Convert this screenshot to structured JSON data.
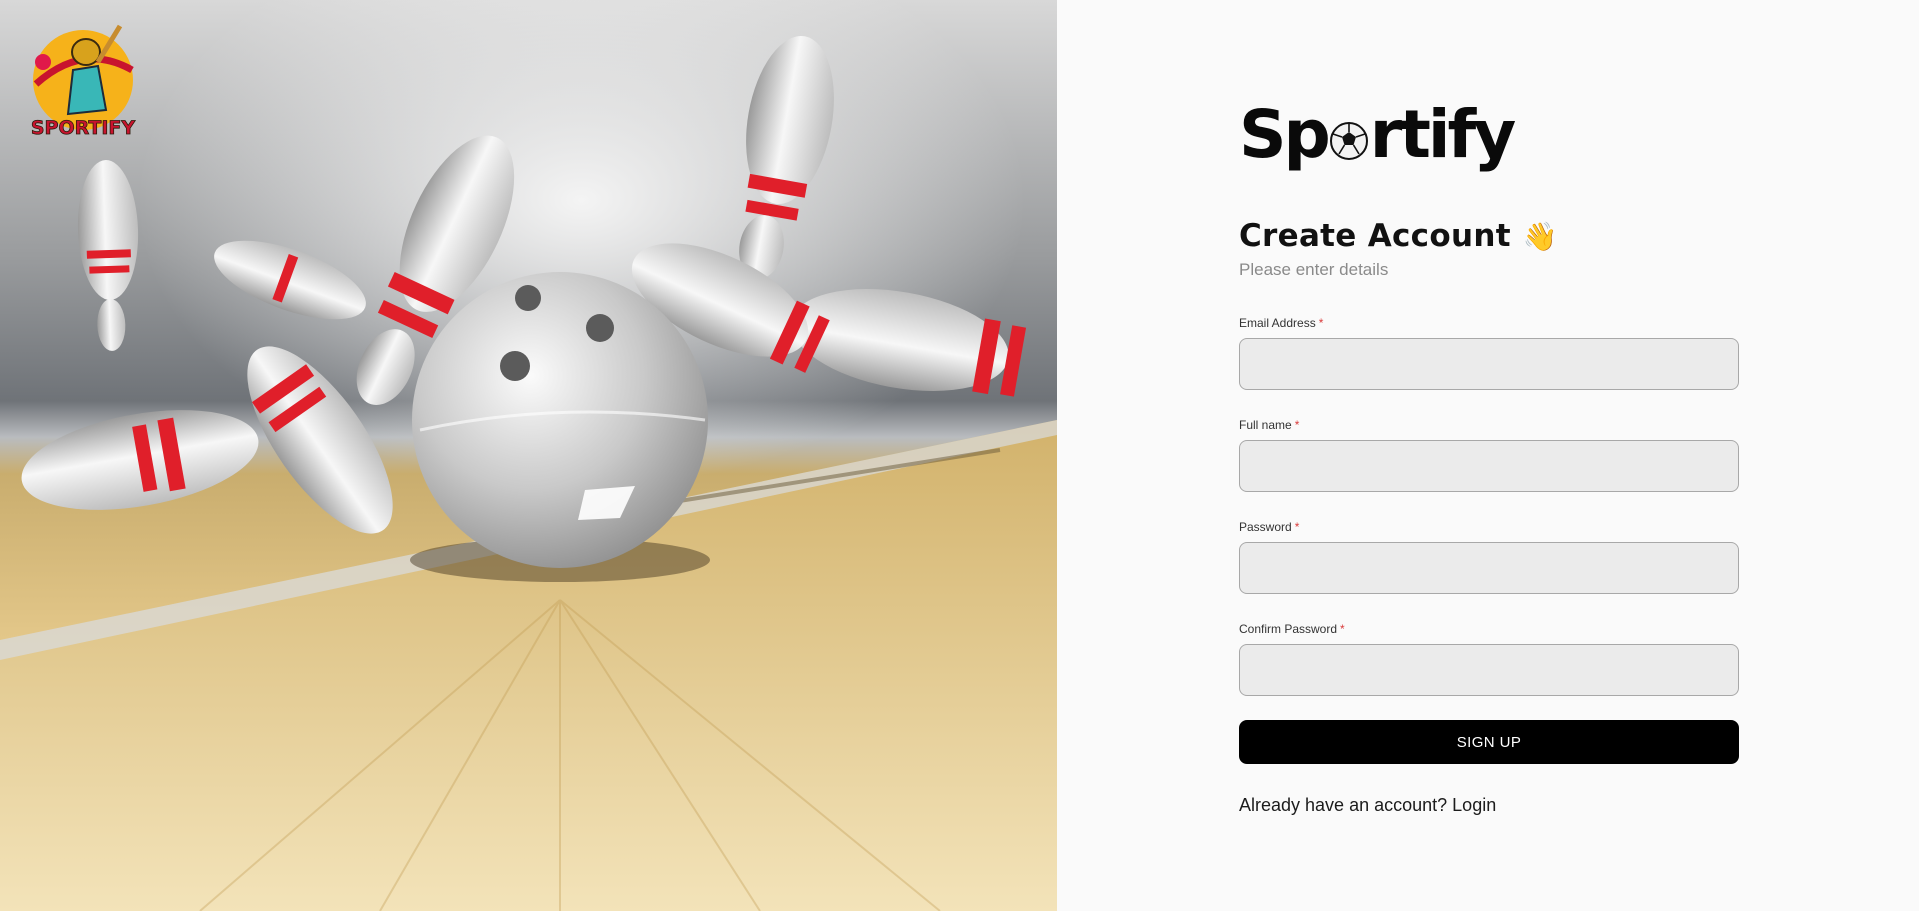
{
  "hero": {
    "image_subject": "bowling-ball-striking-pins",
    "badge_text": "SPORTIFY"
  },
  "brand": {
    "part1": "Sp",
    "part2": "rtify"
  },
  "form": {
    "title": "Create Account",
    "title_emoji": "👋",
    "subtitle": "Please enter details",
    "required_marker": "*",
    "fields": [
      {
        "label": "Email Address",
        "value": "",
        "type": "email"
      },
      {
        "label": "Full name",
        "value": "",
        "type": "text"
      },
      {
        "label": "Password",
        "value": "",
        "type": "password"
      },
      {
        "label": "Confirm Password",
        "value": "",
        "type": "password"
      }
    ],
    "submit_label": "SIGN UP",
    "login_prompt": "Already have an account?",
    "login_link": "Login"
  },
  "colors": {
    "primary": "#000000",
    "required": "#d93a3a",
    "input_bg": "#ebebeb",
    "input_border": "#a8a8a8",
    "subtitle": "#8a8a8a"
  }
}
